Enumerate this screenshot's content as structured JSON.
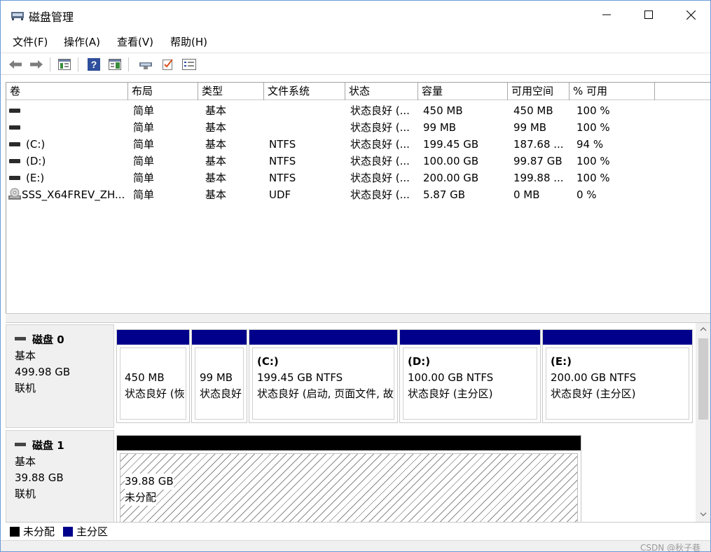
{
  "window": {
    "title": "磁盘管理",
    "minimize_glyph": "—",
    "maximize_glyph": "☐",
    "close_glyph": "✕"
  },
  "menu": [
    "文件(F)",
    "操作(A)",
    "查看(V)",
    "帮助(H)"
  ],
  "toolbar": {
    "icons": [
      "back-arrow-icon",
      "forward-arrow-icon",
      "console-tree-icon",
      "help-icon",
      "action-pane-icon",
      "connect-icon",
      "checklist-icon",
      "properties-icon"
    ]
  },
  "volume_list": {
    "columns": [
      "卷",
      "布局",
      "类型",
      "文件系统",
      "状态",
      "容量",
      "可用空间",
      "% 可用"
    ],
    "rows": [
      {
        "volume": "",
        "icon": "disk-icon",
        "layout": "简单",
        "type": "基本",
        "fs": "",
        "status": "状态良好 (...",
        "capacity": "450 MB",
        "free": "450 MB",
        "pct": "100 %"
      },
      {
        "volume": "",
        "icon": "disk-icon",
        "layout": "简单",
        "type": "基本",
        "fs": "",
        "status": "状态良好 (...",
        "capacity": "99 MB",
        "free": "99 MB",
        "pct": "100 %"
      },
      {
        "volume": "(C:)",
        "icon": "disk-icon",
        "layout": "简单",
        "type": "基本",
        "fs": "NTFS",
        "status": "状态良好 (...",
        "capacity": "199.45 GB",
        "free": "187.68 ...",
        "pct": "94 %"
      },
      {
        "volume": "(D:)",
        "icon": "disk-icon",
        "layout": "简单",
        "type": "基本",
        "fs": "NTFS",
        "status": "状态良好 (...",
        "capacity": "100.00 GB",
        "free": "99.87 GB",
        "pct": "100 %"
      },
      {
        "volume": "(E:)",
        "icon": "disk-icon",
        "layout": "简单",
        "type": "基本",
        "fs": "NTFS",
        "status": "状态良好 (...",
        "capacity": "200.00 GB",
        "free": "199.88 ...",
        "pct": "100 %"
      },
      {
        "volume": "SSS_X64FREV_ZH...",
        "icon": "cd-drive-icon",
        "layout": "简单",
        "type": "基本",
        "fs": "UDF",
        "status": "状态良好 (...",
        "capacity": "5.87 GB",
        "free": "0 MB",
        "pct": "0 %"
      }
    ]
  },
  "disks": [
    {
      "name": "磁盘 0",
      "type": "基本",
      "size": "499.98 GB",
      "state": "联机",
      "partitions": [
        {
          "title": "",
          "size": "450 MB",
          "status": "状态良好 (恢"
        },
        {
          "title": "",
          "size": "99 MB",
          "status": "状态良好"
        },
        {
          "title": "(C:)",
          "size": "199.45 GB NTFS",
          "status": "状态良好 (启动, 页面文件, 故"
        },
        {
          "title": "(D:)",
          "size": "100.00 GB NTFS",
          "status": "状态良好 (主分区)"
        },
        {
          "title": "(E:)",
          "size": "200.00 GB NTFS",
          "status": "状态良好 (主分区)"
        }
      ]
    },
    {
      "name": "磁盘 1",
      "type": "基本",
      "size": "39.88 GB",
      "state": "联机",
      "partitions": [
        {
          "size": "39.88 GB",
          "status": "未分配"
        }
      ]
    }
  ],
  "legend": [
    {
      "label": "未分配",
      "color": "#000000"
    },
    {
      "label": "主分区",
      "color": "#00008b"
    }
  ],
  "colors": {
    "primary_partition": "#00008b",
    "unallocated": "#000000",
    "window_border": "#6b9ad6"
  },
  "watermark": "CSDN @秋子巷"
}
